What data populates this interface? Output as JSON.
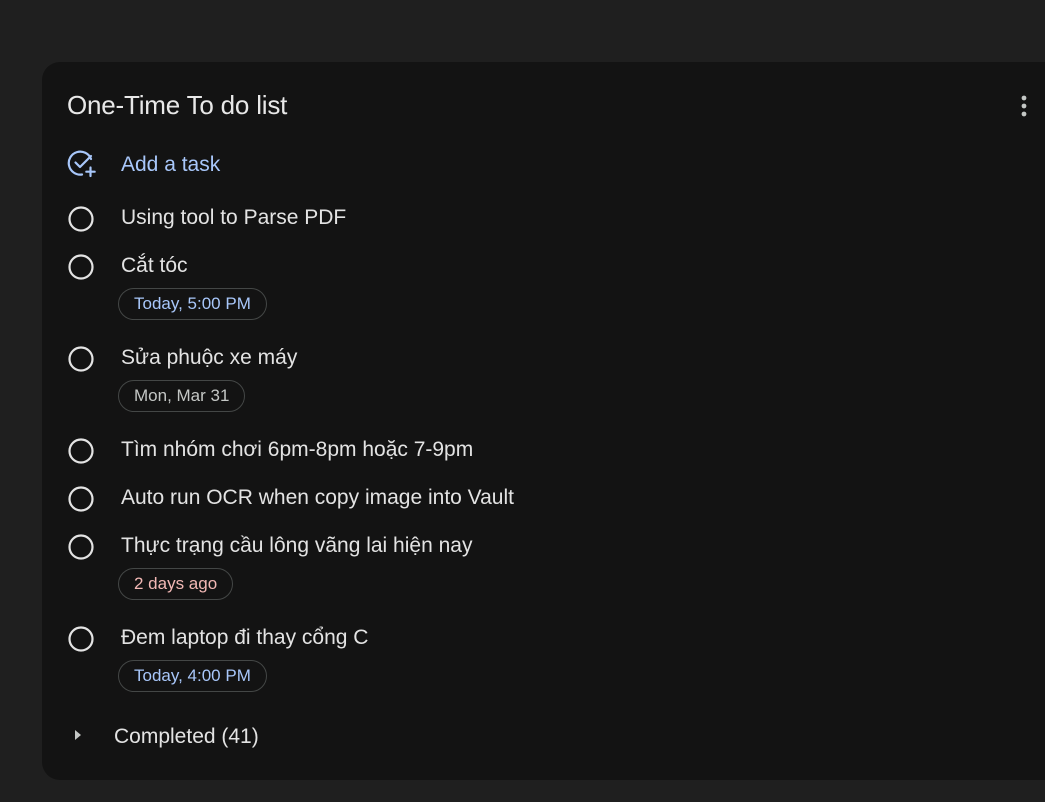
{
  "list": {
    "title": "One-Time To do list",
    "menu_icon": "more-vert-icon"
  },
  "add_task": {
    "label": "Add a task",
    "icon": "add-task-icon"
  },
  "tasks": [
    {
      "title": "Using tool to Parse PDF"
    },
    {
      "title": "Cắt tóc",
      "due": "Today, 5:00 PM",
      "due_color": "#a8c7fa"
    },
    {
      "title": "Sửa phuộc xe máy",
      "due": "Mon, Mar 31",
      "due_color": "#c4c7c5"
    },
    {
      "title": "Tìm nhóm chơi 6pm-8pm hoặc 7-9pm"
    },
    {
      "title": "Auto run OCR when copy image into Vault"
    },
    {
      "title": "Thực trạng cầu lông vãng lai hiện nay",
      "due": "2 days ago",
      "due_color": "#f2b8b5"
    },
    {
      "title": "Đem laptop đi thay cổng C",
      "due": "Today, 4:00 PM",
      "due_color": "#a8c7fa"
    }
  ],
  "completed": {
    "label": "Completed (41)",
    "icon": "expand-arrow-icon"
  },
  "colors": {
    "background": "#1f1f1f",
    "card": "#131313",
    "accent": "#a8c7fa",
    "overdue": "#f2b8b5"
  }
}
